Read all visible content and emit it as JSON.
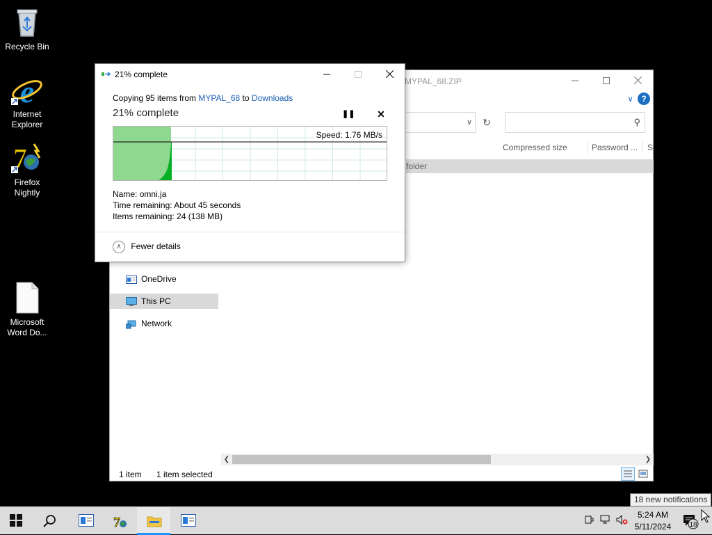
{
  "desktop": {
    "icons": [
      {
        "label": "Recycle Bin"
      },
      {
        "label": "Internet Explorer"
      },
      {
        "label": "Firefox Nightly"
      },
      {
        "label": "Microsoft Word Do..."
      }
    ]
  },
  "explorer": {
    "title": "MYPAL_68.ZIP",
    "columns": [
      "Compressed size",
      "Password ...",
      "Si"
    ],
    "selected_row_type": "folder",
    "nav": [
      {
        "label": "OneDrive"
      },
      {
        "label": "This PC"
      },
      {
        "label": "Network"
      }
    ],
    "status_items": "1 item",
    "status_selected": "1 item selected",
    "help": "?"
  },
  "copy_dialog": {
    "title": "21% complete",
    "copying_prefix": "Copying 95 items from",
    "source": "MYPAL_68",
    "to_word": "to",
    "destination": "Downloads",
    "percent_text": "21% complete",
    "progress_fraction": 0.21,
    "speed": "Speed: 1.76 MB/s",
    "name_label": "Name:",
    "name_value": "omni.ja",
    "time_label": "Time remaining:",
    "time_value": "About 45 seconds",
    "items_label": "Items remaining:",
    "items_value": "24 (138 MB)",
    "fewer_details": "Fewer details"
  },
  "taskbar": {
    "apps": [
      "start",
      "search",
      "explorer-window",
      "firefox-nightly",
      "file-explorer",
      "explorer-window-2"
    ],
    "time": "5:24 AM",
    "date": "5/11/2024",
    "notification_count": "18",
    "notification_tooltip": "18 new notifications"
  },
  "colors": {
    "progress_green": "#8fd88f",
    "graph_fill": "#06b025",
    "link_blue": "#1a5fb4",
    "taskbar_active": "#1e90ff"
  }
}
